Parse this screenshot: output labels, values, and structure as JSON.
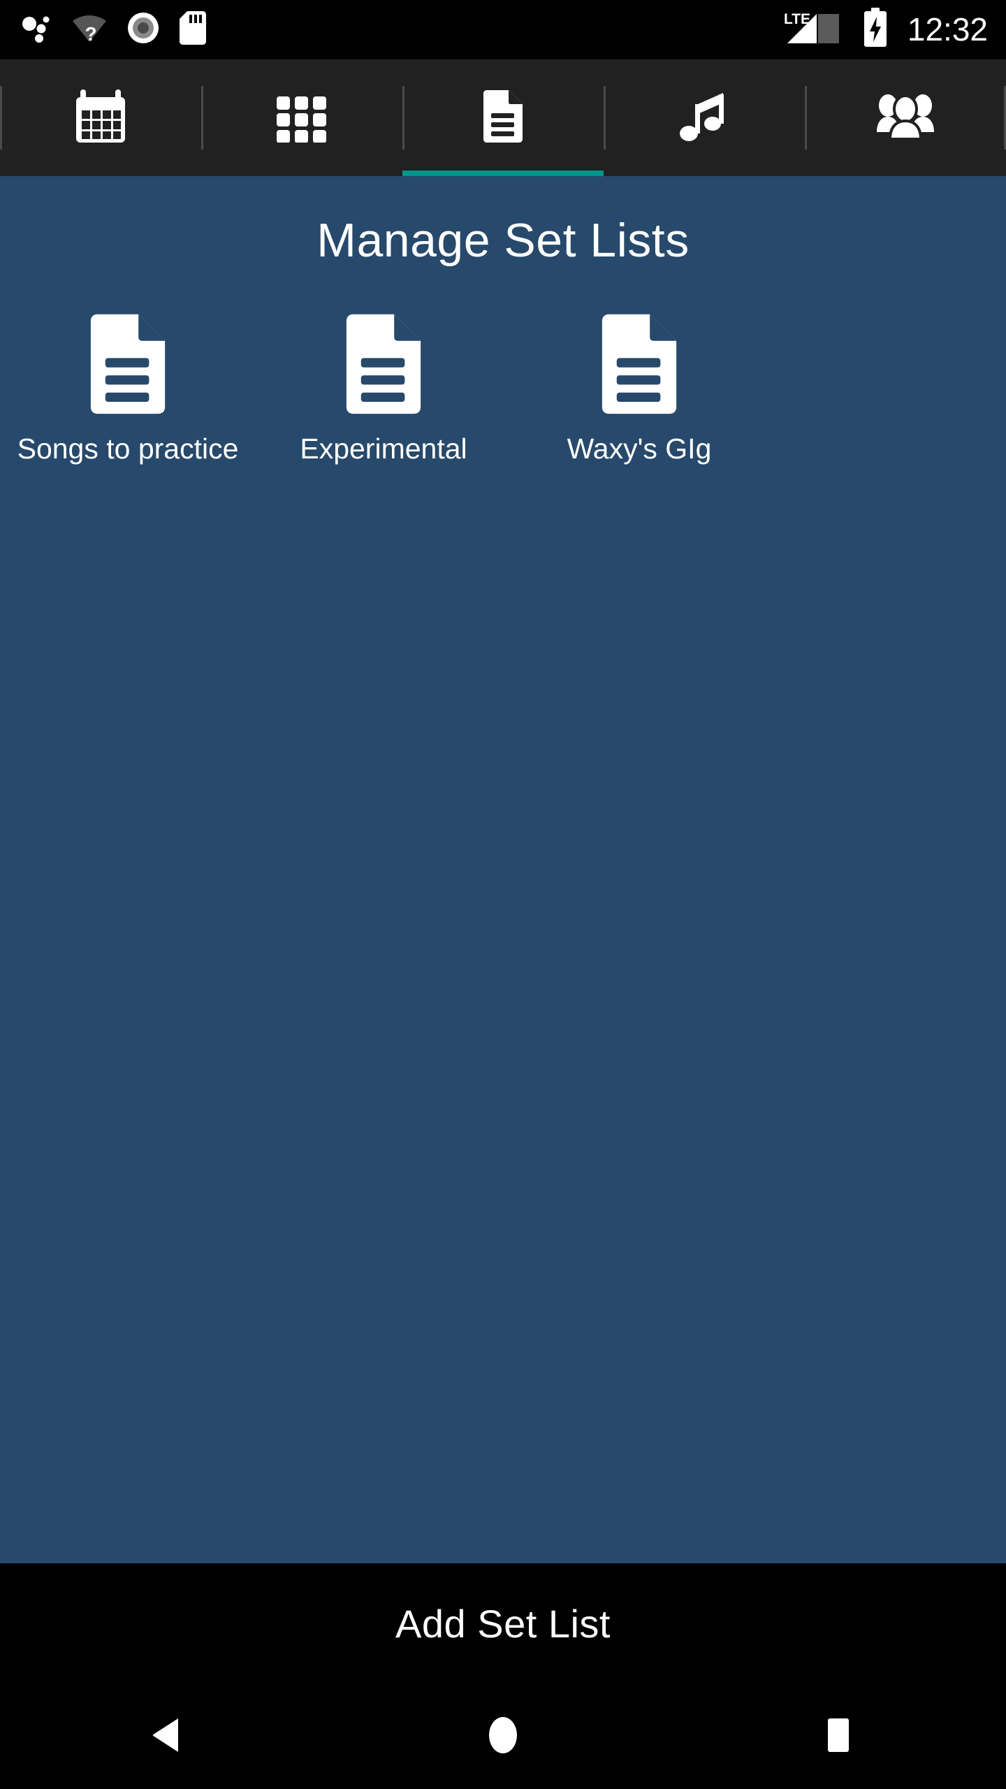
{
  "status_bar": {
    "icons": [
      {
        "name": "bubbles-icon",
        "label": "notification-dots"
      },
      {
        "name": "wifi-unknown-icon",
        "label": "wifi-question"
      },
      {
        "name": "location-record-icon",
        "label": "location"
      },
      {
        "name": "sd-card-icon",
        "label": "sd-card"
      }
    ],
    "network_label": "LTE",
    "signal_icon": "signal-bars-icon",
    "battery_icon": "battery-charging-icon",
    "clock": "12:32"
  },
  "tabs": {
    "accent_color": "#00968a",
    "bar_color": "#212121",
    "items": [
      {
        "icon": "calendar-icon",
        "name": "tab-calendar",
        "active": false
      },
      {
        "icon": "grid-icon",
        "name": "tab-grid",
        "active": false
      },
      {
        "icon": "document-icon",
        "name": "tab-setlists",
        "active": true
      },
      {
        "icon": "music-note-icon",
        "name": "tab-songs",
        "active": false
      },
      {
        "icon": "people-icon",
        "name": "tab-bands",
        "active": false
      }
    ]
  },
  "main": {
    "background_color": "#27496b",
    "title": "Manage Set Lists",
    "setlists": [
      {
        "label": "Songs to practice",
        "icon": "document-icon"
      },
      {
        "label": "Experimental",
        "icon": "document-icon"
      },
      {
        "label": "Waxy's GIg",
        "icon": "document-icon"
      }
    ]
  },
  "add_bar": {
    "label": "Add Set List",
    "background_color": "#000000"
  },
  "nav_bar": {
    "buttons": [
      {
        "name": "nav-back-button",
        "icon": "triangle-left-icon"
      },
      {
        "name": "nav-home-button",
        "icon": "circle-icon"
      },
      {
        "name": "nav-recents-button",
        "icon": "square-icon"
      }
    ]
  }
}
